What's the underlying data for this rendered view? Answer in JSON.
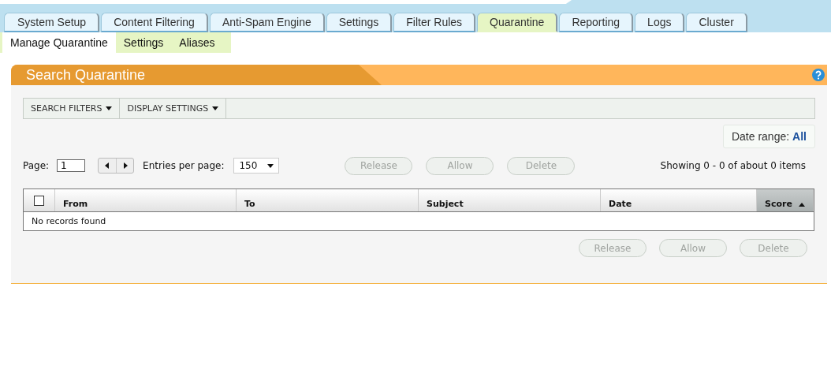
{
  "tabs": [
    {
      "label": "System Setup",
      "selected": false
    },
    {
      "label": "Content Filtering",
      "selected": false
    },
    {
      "label": "Anti-Spam Engine",
      "selected": false
    },
    {
      "label": "Settings",
      "selected": false
    },
    {
      "label": "Filter Rules",
      "selected": false
    },
    {
      "label": "Quarantine",
      "selected": true
    },
    {
      "label": "Reporting",
      "selected": false
    },
    {
      "label": "Logs",
      "selected": false
    },
    {
      "label": "Cluster",
      "selected": false
    }
  ],
  "subtabs": [
    {
      "label": "Manage Quarantine",
      "selected": true
    },
    {
      "label": "Settings",
      "selected": false
    },
    {
      "label": "Aliases",
      "selected": false
    }
  ],
  "panel": {
    "title": "Search Quarantine",
    "toolbar": [
      "SEARCH FILTERS",
      "DISPLAY SETTINGS"
    ],
    "date_range": {
      "label": "Date range:",
      "value": "All"
    },
    "pager": {
      "page_label": "Page:",
      "page_value": "1",
      "entries_label": "Entries per page:",
      "entries_value": "150"
    },
    "top_actions": [
      {
        "label": "Release",
        "disabled": true
      },
      {
        "label": "Allow",
        "disabled": true
      },
      {
        "label": "Delete",
        "disabled": true
      }
    ],
    "summary": "Showing 0 - 0 of about 0 items",
    "table": {
      "select_all": {
        "checked": false
      },
      "columns": [
        {
          "label": "From",
          "sorted": false
        },
        {
          "label": "To",
          "sorted": false
        },
        {
          "label": "Subject",
          "sorted": false
        },
        {
          "label": "Date",
          "sorted": false
        },
        {
          "label": "Score",
          "sorted": true
        }
      ],
      "empty_message": "No records found"
    },
    "bottom_actions": [
      {
        "label": "Release",
        "disabled": true
      },
      {
        "label": "Allow",
        "disabled": true
      },
      {
        "label": "Delete",
        "disabled": true
      }
    ]
  }
}
